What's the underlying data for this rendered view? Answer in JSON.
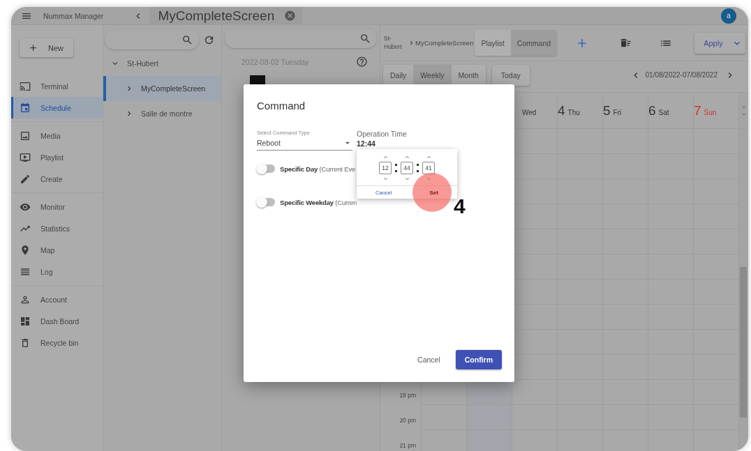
{
  "header": {
    "app_name": "Nummax Manager",
    "tab": {
      "title": "MyCompleteScreen"
    },
    "avatar": "a"
  },
  "sidebar": {
    "new_button": "New",
    "groups": [
      [
        {
          "label": "Terminal",
          "selected": false
        },
        {
          "label": "Schedule",
          "selected": true
        }
      ],
      [
        {
          "label": "Media",
          "selected": false
        },
        {
          "label": "Playlist",
          "selected": false
        },
        {
          "label": "Create",
          "selected": false
        }
      ],
      [
        {
          "label": "Monitor",
          "selected": false
        },
        {
          "label": "Statistics",
          "selected": false
        },
        {
          "label": "Map",
          "selected": false
        },
        {
          "label": "Log",
          "selected": false
        }
      ],
      [
        {
          "label": "Account",
          "selected": false
        },
        {
          "label": "Dash Board",
          "selected": false
        },
        {
          "label": "Recycle bin",
          "selected": false
        }
      ]
    ]
  },
  "tree": {
    "items": [
      {
        "label": "St-Hubert",
        "expanded": true,
        "selected": false,
        "children": [
          {
            "label": "MyCompleteScreen",
            "expanded": false,
            "selected": true
          },
          {
            "label": "Salle de montre",
            "expanded": false,
            "selected": false
          }
        ]
      }
    ]
  },
  "list": {
    "date": "2022-08-02 Tuesday"
  },
  "toolbar": {
    "breadcrumb": [
      "St-Hubert",
      "MyCompleteScreen"
    ],
    "mode_tabs": [
      {
        "label": "Playlist",
        "selected": false
      },
      {
        "label": "Command",
        "selected": true
      }
    ],
    "apply": "Apply",
    "views": [
      {
        "label": "Daily",
        "selected": false
      },
      {
        "label": "Weekly",
        "selected": true
      },
      {
        "label": "Month",
        "selected": false
      }
    ],
    "today": "Today",
    "range": "01/08/2022-07/08/2022"
  },
  "calendar": {
    "days": [
      {
        "name": "Wed",
        "color": "#333333"
      },
      {
        "number": "4",
        "name": "Thu",
        "color": "#333333"
      },
      {
        "number": "5",
        "name": "Fri",
        "color": "#333333"
      },
      {
        "number": "6",
        "name": "Sat",
        "color": "#333333"
      },
      {
        "number": "7",
        "name": "Sun",
        "color": "#d32f2f"
      }
    ],
    "hours": [
      "19 pm",
      "20 pm",
      "21 pm"
    ]
  },
  "dialog": {
    "title": "Command",
    "command_type": {
      "label": "Select Command Type",
      "value": "Reboot"
    },
    "operation_time": {
      "label": "Operation Time",
      "value": "12:44"
    },
    "toggles": [
      {
        "label": "Specific Day",
        "hint": "(Current Eve",
        "on": false
      },
      {
        "label": "Specific Weekday",
        "hint": "(Curren",
        "on": false
      }
    ],
    "time_picker": {
      "fields": [
        "12",
        "44",
        "41"
      ],
      "cancel": "Cancel",
      "set": "Set"
    },
    "cancel": "Cancel",
    "confirm": "Confirm"
  },
  "annotation": {
    "step": "4"
  }
}
